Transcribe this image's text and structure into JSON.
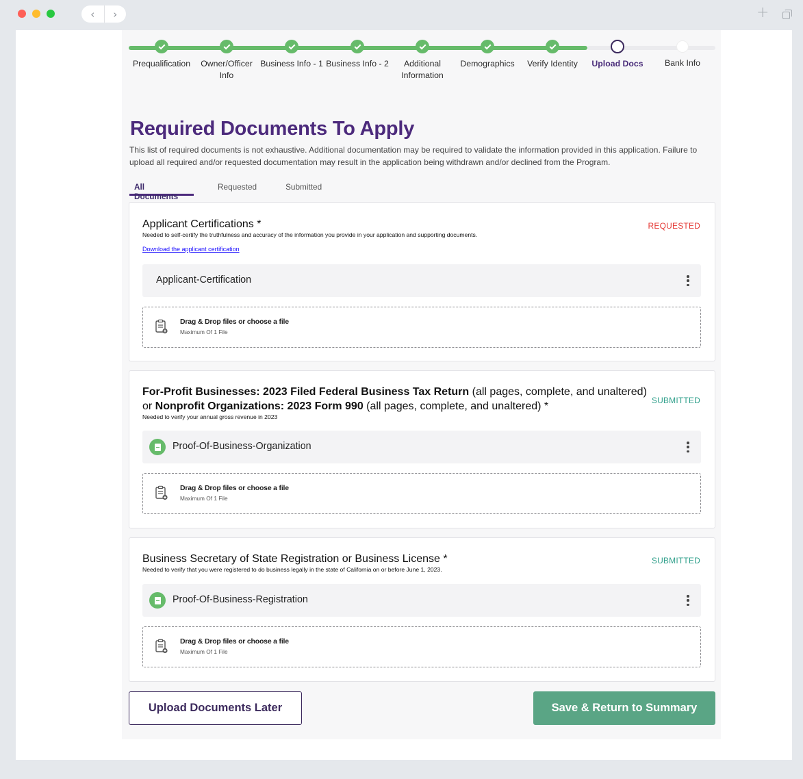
{
  "browser": {
    "back_glyph": "‹",
    "forward_glyph": "›",
    "new_tab_glyph": "+"
  },
  "stepper": {
    "steps": [
      {
        "label": "Prequalification",
        "state": "done"
      },
      {
        "label": "Owner/Officer Info",
        "state": "done"
      },
      {
        "label": "Business Info - 1",
        "state": "done"
      },
      {
        "label": "Business Info - 2",
        "state": "done"
      },
      {
        "label": "Additional Information",
        "state": "done"
      },
      {
        "label": "Demographics",
        "state": "done"
      },
      {
        "label": "Verify Identity",
        "state": "done"
      },
      {
        "label": "Upload Docs",
        "state": "current"
      },
      {
        "label": "Bank Info",
        "state": "todo"
      }
    ]
  },
  "page": {
    "title": "Required Documents To Apply",
    "intro": "This list of required documents is not exhaustive. Additional documentation may be required to validate the information provided in this application. Failure to upload all required and/or requested documentation may result in the application being withdrawn and/or declined from the Program."
  },
  "tabs": {
    "all": "All Documents",
    "requested": "Requested",
    "submitted": "Submitted"
  },
  "cards": [
    {
      "title": "Applicant Certifications *",
      "subtitle": "Needed to self-certify the truthfulness and accuracy of the information you provide in your application and supporting documents.",
      "link": "Download the applicant certification",
      "status": "REQUESTED",
      "file": "Applicant-Certification",
      "dropzone_title": "Drag & Drop files or choose a file",
      "dropzone_sub": "Maximum Of 1 File"
    },
    {
      "title_part1_bold": "For-Profit Businesses: 2023 Filed Federal Business Tax Return",
      "title_part2": " (all pages, complete, and unaltered)",
      "title_part3": "or ",
      "title_part4_bold": "Nonprofit Organizations: 2023 Form 990",
      "title_part5": " (all pages, complete, and unaltered) *",
      "subtitle": "Needed to verify your annual gross revenue in 2023",
      "status": "SUBMITTED",
      "file": "Proof-Of-Business-Organization",
      "dropzone_title": "Drag & Drop files or choose a file",
      "dropzone_sub": "Maximum Of 1 File"
    },
    {
      "title": "Business Secretary of State Registration or Business License *",
      "subtitle": "Needed to verify that you were registered to do business legally in the state of California on or before June 1, 2023.",
      "status": "SUBMITTED",
      "file": "Proof-Of-Business-Registration",
      "dropzone_title": "Drag & Drop files or choose a file",
      "dropzone_sub": "Maximum Of 1 File"
    }
  ],
  "actions": {
    "later": "Upload Documents Later",
    "save": "Save & Return to Summary"
  },
  "colors": {
    "accent": "#4c2a7c",
    "success": "#66bb6a",
    "save_button": "#5aa585",
    "requested": "#e53935",
    "submitted": "#2e9f8a"
  }
}
